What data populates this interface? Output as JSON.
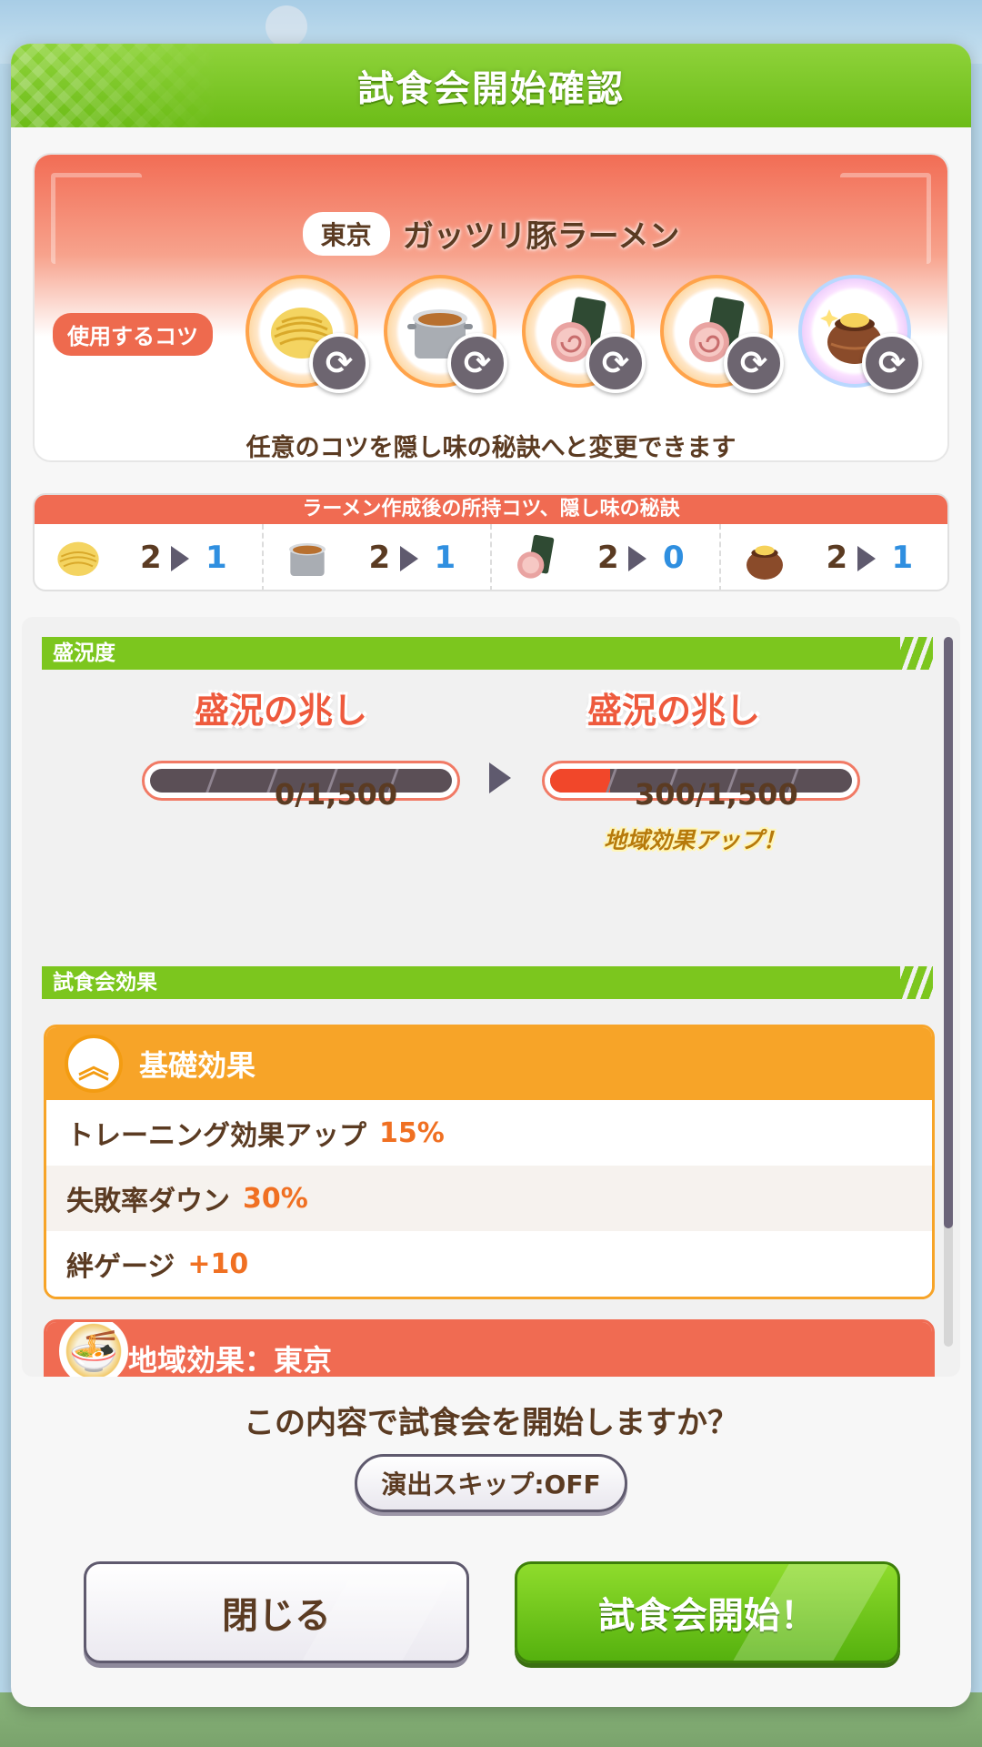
{
  "dialog": {
    "title": "試食会開始確認"
  },
  "recipe": {
    "region": "東京",
    "dish": "ガッツリ豚ラーメン",
    "tips_label": "使用するコツ",
    "tips": [
      {
        "icon": "noodles-icon"
      },
      {
        "icon": "soup-pot-icon"
      },
      {
        "icon": "chashu-nori-icon"
      },
      {
        "icon": "chashu-nori-icon"
      },
      {
        "icon": "secret-jar-icon"
      }
    ],
    "note": "任意のコツを隠し味の秘訣へと変更できます"
  },
  "inventory": {
    "title": "ラーメン作成後の所持コツ、隠し味の秘訣",
    "items": [
      {
        "icon": "noodles-icon",
        "from": "2",
        "to": "1"
      },
      {
        "icon": "soup-pot-icon",
        "from": "2",
        "to": "1"
      },
      {
        "icon": "chashu-nori-icon",
        "from": "2",
        "to": "0"
      },
      {
        "icon": "secret-jar-icon",
        "from": "2",
        "to": "1"
      }
    ]
  },
  "prosperity": {
    "section": "盛況度",
    "before": {
      "label": "盛況の兆し",
      "value": "0/1,500",
      "progress": 0.0
    },
    "after": {
      "label": "盛況の兆し",
      "value": "300/1,500",
      "progress": 0.2,
      "note": "地域効果アップ！"
    }
  },
  "effects": {
    "section": "試食会効果",
    "basic": {
      "title": "基礎効果",
      "rows": [
        {
          "label": "トレーニング効果アップ",
          "value": "15%"
        },
        {
          "label": "失敗率ダウン",
          "value": "30%"
        },
        {
          "label": "絆ゲージ",
          "value": "+10"
        }
      ]
    },
    "regional": {
      "title": "地域効果：東京"
    }
  },
  "confirm": {
    "question": "この内容で試食会を開始しますか？",
    "skip": "演出スキップ:OFF",
    "close": "閉じる",
    "start": "試食会開始！"
  },
  "colors": {
    "header_green": "#6cbc17",
    "accent_red": "#f06b52",
    "accent_orange": "#f7a428",
    "value_blue": "#2f8fe0"
  }
}
